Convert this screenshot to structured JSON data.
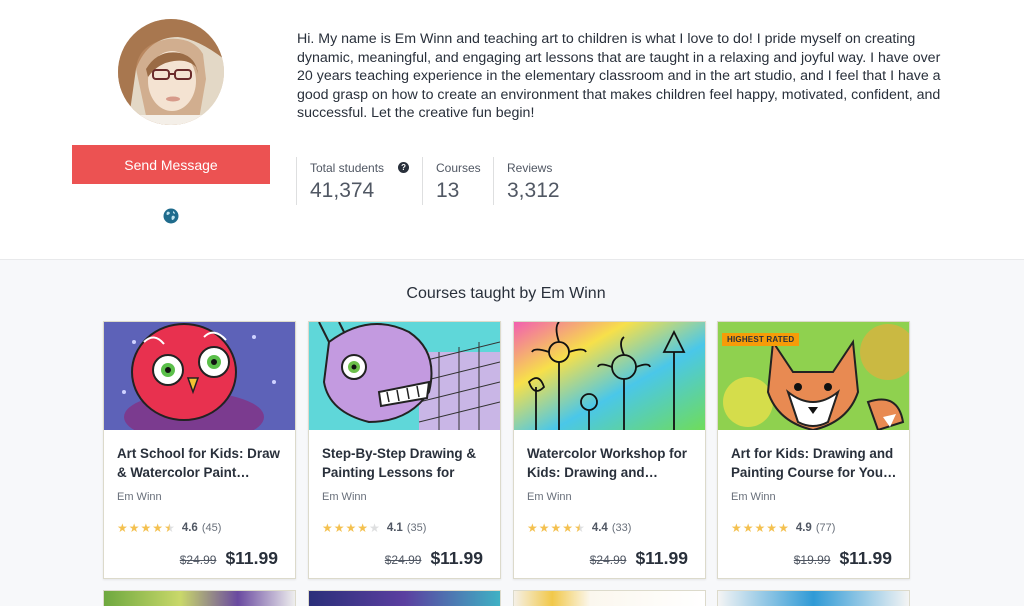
{
  "profile": {
    "avatar_icon": "instructor-photo",
    "send_message_label": "Send Message",
    "globe_icon": "globe-icon",
    "bio": "Hi. My name is Em Winn and teaching art to children is what I love to do! I pride myself on creating dynamic, meaningful, and engaging art lessons that are taught in a relaxing and joyful way. I have over 20 years teaching experience in the elementary classroom and in the art studio, and I feel that I have a good grasp on how to create an environment that makes children feel happy, motivated, confident, and successful. Let the creative fun begin!",
    "stats": [
      {
        "label": "Total students",
        "value": "41,374",
        "has_help": true
      },
      {
        "label": "Courses",
        "value": "13",
        "has_help": false
      },
      {
        "label": "Reviews",
        "value": "3,312",
        "has_help": false
      }
    ],
    "help_icon_glyph": "?"
  },
  "courses_section": {
    "title": "Courses taught by Em Winn",
    "courses": [
      {
        "title": "Art School for Kids: Draw & Watercolor Paint…",
        "author": "Em Winn",
        "rating": "4.6",
        "rating_value": 4.6,
        "count": "(45)",
        "old_price": "$24.99",
        "price": "$11.99",
        "badge": ""
      },
      {
        "title": "Step-By-Step Drawing & Painting Lessons for Kid…",
        "author": "Em Winn",
        "rating": "4.1",
        "rating_value": 4.1,
        "count": "(35)",
        "old_price": "$24.99",
        "price": "$11.99",
        "badge": ""
      },
      {
        "title": "Watercolor Workshop for Kids: Drawing and…",
        "author": "Em Winn",
        "rating": "4.4",
        "rating_value": 4.4,
        "count": "(33)",
        "old_price": "$24.99",
        "price": "$11.99",
        "badge": ""
      },
      {
        "title": "Art for Kids: Drawing and Painting Course for You…",
        "author": "Em Winn",
        "rating": "4.9",
        "rating_value": 4.9,
        "count": "(77)",
        "old_price": "$19.99",
        "price": "$11.99",
        "badge": "HIGHEST RATED"
      }
    ]
  },
  "colors": {
    "accent": "#ec5252",
    "star": "#f4c150",
    "badge": "#f69c08",
    "section_bg": "#f7f8fa"
  }
}
